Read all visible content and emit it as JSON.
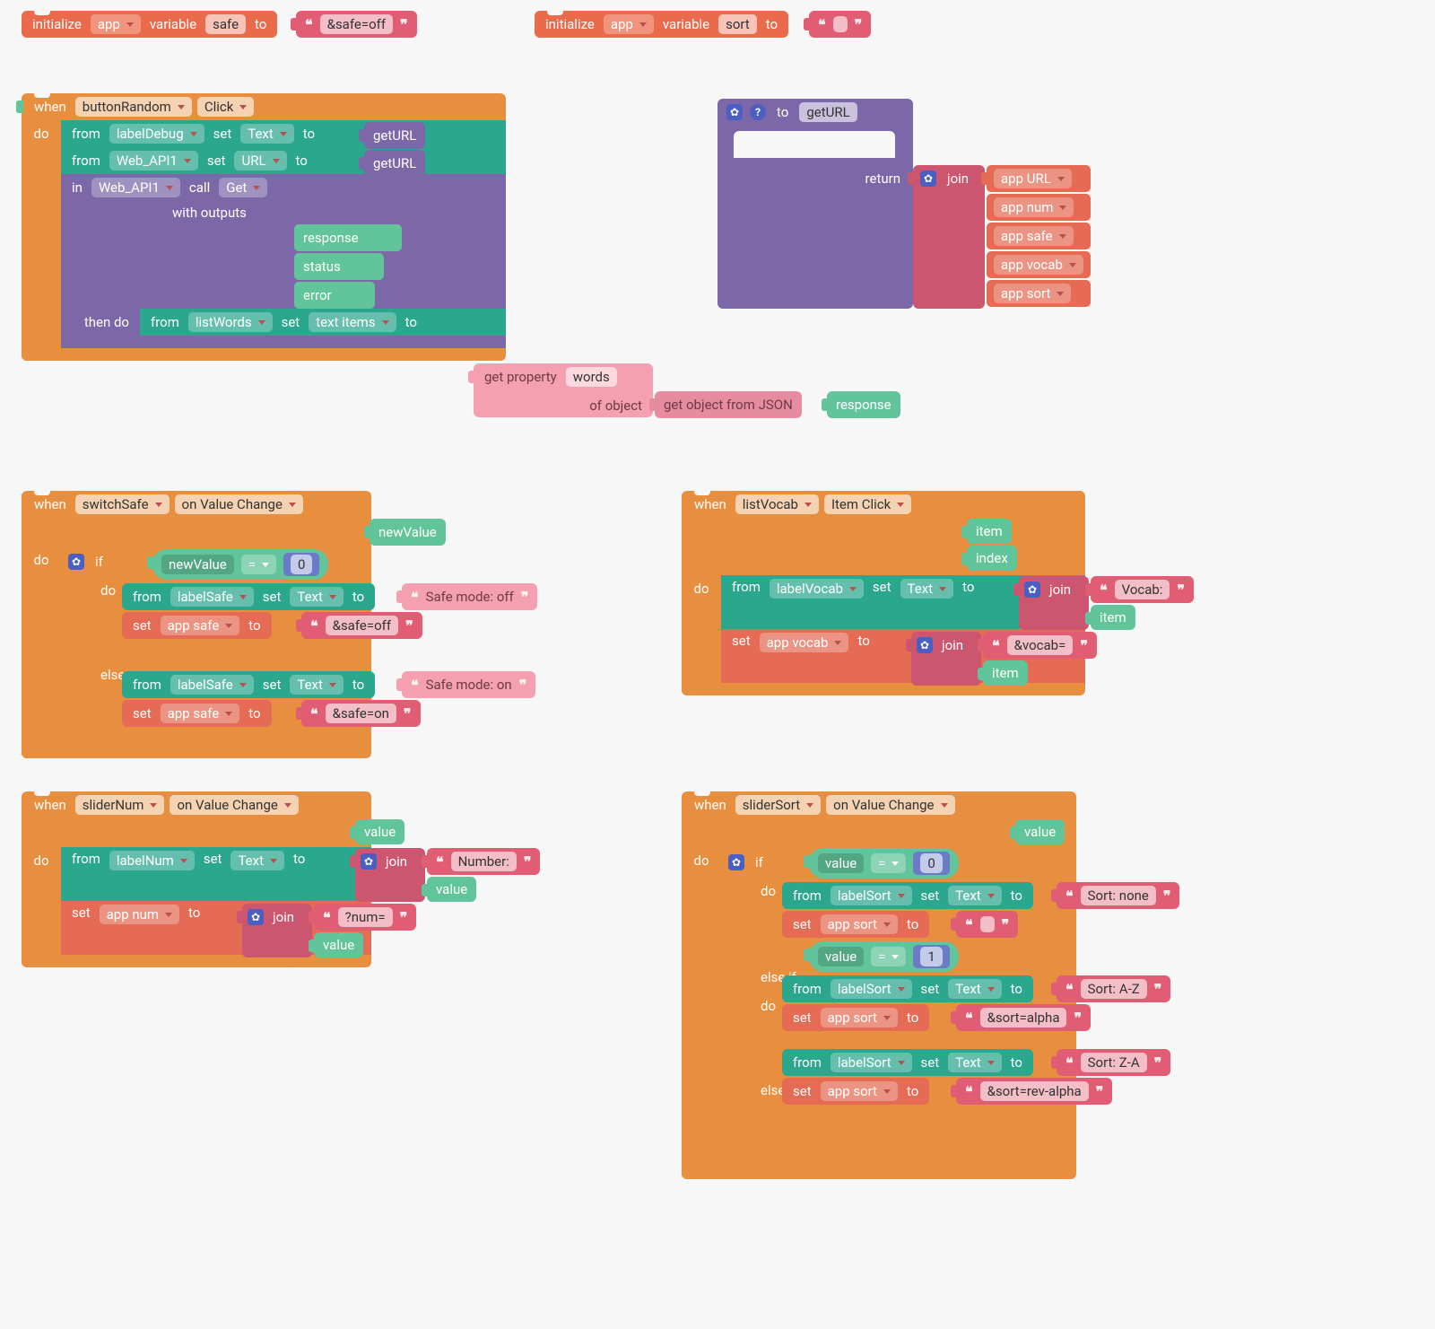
{
  "kw": {
    "initialize": "initialize",
    "app": "app",
    "variable": "variable",
    "to": "to",
    "when": "when",
    "do": "do",
    "from": "from",
    "set": "set",
    "in": "in",
    "call": "call",
    "with_outputs": "with outputs",
    "then_do": "then do",
    "return": "return",
    "if": "if",
    "else": "else",
    "else_if": "else if",
    "join": "join",
    "get_property": "get property",
    "of_object": "of object",
    "get_object_json": "get object from JSON"
  },
  "init_safe": {
    "var": "safe",
    "value": "&safe=off"
  },
  "init_sort": {
    "var": "sort",
    "value": ""
  },
  "button_random": {
    "component": "buttonRandom",
    "event": "Click",
    "line1": {
      "from": "labelDebug",
      "prop": "Text",
      "val": "getURL"
    },
    "line2": {
      "from": "Web_API1",
      "prop": "URL",
      "val": "getURL"
    },
    "line3": {
      "in": "Web_API1",
      "method": "Get"
    },
    "outputs": [
      "response",
      "status",
      "error"
    ],
    "then": {
      "from": "listWords",
      "prop": "text items",
      "get_prop": "words",
      "json_src": "response"
    }
  },
  "geturl": {
    "name": "getURL",
    "joins": [
      "app URL",
      "app num",
      "app safe",
      "app vocab",
      "app sort"
    ]
  },
  "switch_safe": {
    "component": "switchSafe",
    "event": "on Value Change",
    "param": "newValue",
    "cond": {
      "left": "newValue",
      "op": "=",
      "right": "0"
    },
    "do1": {
      "from": "labelSafe",
      "prop": "Text",
      "val": "Safe mode: off"
    },
    "do2": {
      "var": "app safe",
      "val": "&safe=off"
    },
    "else1": {
      "from": "labelSafe",
      "prop": "Text",
      "val": "Safe mode: on"
    },
    "else2": {
      "var": "app safe",
      "val": "&safe=on"
    }
  },
  "list_vocab": {
    "component": "listVocab",
    "event": "Item Click",
    "params": [
      "item",
      "index"
    ],
    "line1": {
      "from": "labelVocab",
      "prop": "Text",
      "join_str": "Vocab:",
      "join_var": "item"
    },
    "line2": {
      "var": "app vocab",
      "join_str": "&vocab=",
      "join_var": "item"
    }
  },
  "slider_num": {
    "component": "sliderNum",
    "event": "on Value Change",
    "param": "value",
    "line1": {
      "from": "labelNum",
      "prop": "Text",
      "join_str": "Number:",
      "join_var": "value"
    },
    "line2": {
      "var": "app num",
      "join_str": "?num=",
      "join_var": "value"
    }
  },
  "slider_sort": {
    "component": "sliderSort",
    "event": "on Value Change",
    "param": "value",
    "cond1": {
      "left": "value",
      "op": "=",
      "right": "0"
    },
    "do1a": {
      "from": "labelSort",
      "prop": "Text",
      "val": "Sort: none"
    },
    "do1b": {
      "var": "app sort",
      "val": ""
    },
    "cond2": {
      "left": "value",
      "op": "=",
      "right": "1"
    },
    "do2a": {
      "from": "labelSort",
      "prop": "Text",
      "val": "Sort: A-Z"
    },
    "do2b": {
      "var": "app sort",
      "val": "&sort=alpha"
    },
    "do3a": {
      "from": "labelSort",
      "prop": "Text",
      "val": "Sort: Z-A"
    },
    "do3b": {
      "var": "app sort",
      "val": "&sort=rev-alpha"
    }
  }
}
